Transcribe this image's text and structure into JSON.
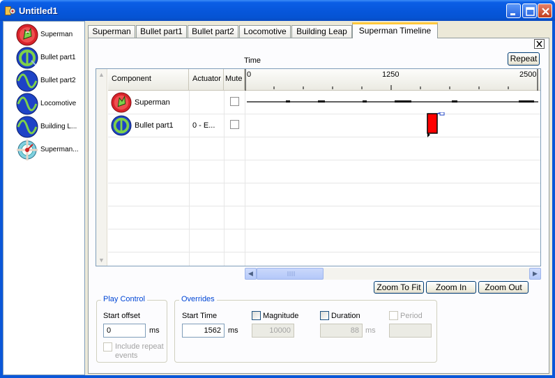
{
  "window": {
    "title": "Untitled1"
  },
  "components": [
    {
      "label": "Superman",
      "icon": "superman-icon"
    },
    {
      "label": "Bullet part1",
      "icon": "bullet-icon"
    },
    {
      "label": "Bullet part2",
      "icon": "wave-icon"
    },
    {
      "label": "Locomotive",
      "icon": "wave-icon"
    },
    {
      "label": "Building L...",
      "icon": "wave-icon"
    },
    {
      "label": "Superman...",
      "icon": "timeline-icon"
    }
  ],
  "tabs": [
    {
      "label": "Superman"
    },
    {
      "label": "Bullet part1"
    },
    {
      "label": "Bullet part2"
    },
    {
      "label": "Locomotive"
    },
    {
      "label": "Building Leap"
    },
    {
      "label": "Superman Timeline",
      "active": true
    }
  ],
  "toolbar": {
    "repeat_label": "Repeat"
  },
  "timeline": {
    "time_caption": "Time",
    "headers": {
      "component": "Component",
      "actuator": "Actuator",
      "mute": "Mute"
    },
    "ruler_ticks": [
      "0",
      "1250",
      "2500"
    ],
    "rows": [
      {
        "component": "Superman",
        "actuator": "",
        "mute": false,
        "icon": "superman-icon"
      },
      {
        "component": "Bullet part1",
        "actuator": "0 - E...",
        "mute": false,
        "icon": "bullet-icon"
      }
    ],
    "event_color": "#ff0000"
  },
  "zoom": {
    "fit_label": "Zoom To Fit",
    "in_label": "Zoom In",
    "out_label": "Zoom Out"
  },
  "play_control": {
    "title": "Play Control",
    "start_offset_label": "Start offset",
    "start_offset_value": "0",
    "unit": "ms",
    "include_repeat_label_1": "Include repeat",
    "include_repeat_label_2": "events"
  },
  "overrides": {
    "title": "Overrides",
    "start_time_label": "Start Time",
    "start_time_value": "1562",
    "start_time_unit": "ms",
    "magnitude_label": "Magnitude",
    "magnitude_value": "10000",
    "duration_label": "Duration",
    "duration_value": "88",
    "duration_unit": "ms",
    "period_label": "Period",
    "period_value": ""
  }
}
